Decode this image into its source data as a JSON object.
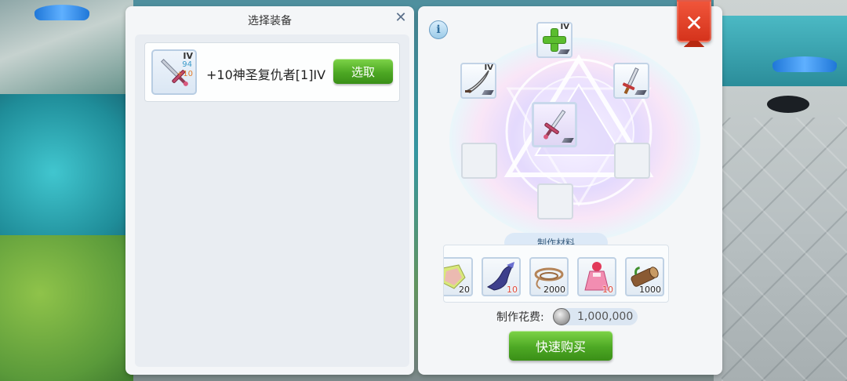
{
  "left_panel": {
    "title": "选择装备",
    "close_glyph": "✕",
    "equipment": [
      {
        "name": "+10神圣复仇者[1]IV",
        "tier": "IV",
        "level": "94",
        "refine": "+10",
        "icon": "holy-avenger-sword-icon",
        "select_label": "选取"
      }
    ]
  },
  "right_panel": {
    "info_glyph": "i",
    "slots": {
      "top": {
        "tier": "IV",
        "icon": "plus-icon"
      },
      "upper_left": {
        "tier": "IV",
        "icon": "curved-blade-icon"
      },
      "upper_right": {
        "tier": "",
        "icon": "dagger-icon"
      },
      "center": {
        "tier": "",
        "icon": "holy-sword-icon"
      }
    },
    "materials_label": "制作材料",
    "materials": [
      {
        "icon": "rainbow-gem-icon",
        "qty": "20",
        "short": false
      },
      {
        "icon": "mermaid-tail-icon",
        "qty": "10",
        "short": true
      },
      {
        "icon": "rope-icon",
        "qty": "2000",
        "short": false
      },
      {
        "icon": "pink-dress-icon",
        "qty": "10",
        "short": true
      },
      {
        "icon": "log-icon",
        "qty": "1000",
        "short": false
      }
    ],
    "cost_label": "制作花费:",
    "cost_value": "1,000,000",
    "buy_label": "快速购买"
  },
  "close_button_glyph": "✕",
  "colors": {
    "accent_green": "#4da824",
    "close_red": "#e0432a",
    "shortage_red": "#e04a3a",
    "refine_orange": "#e27b2a",
    "level_blue": "#3a9ac9"
  }
}
